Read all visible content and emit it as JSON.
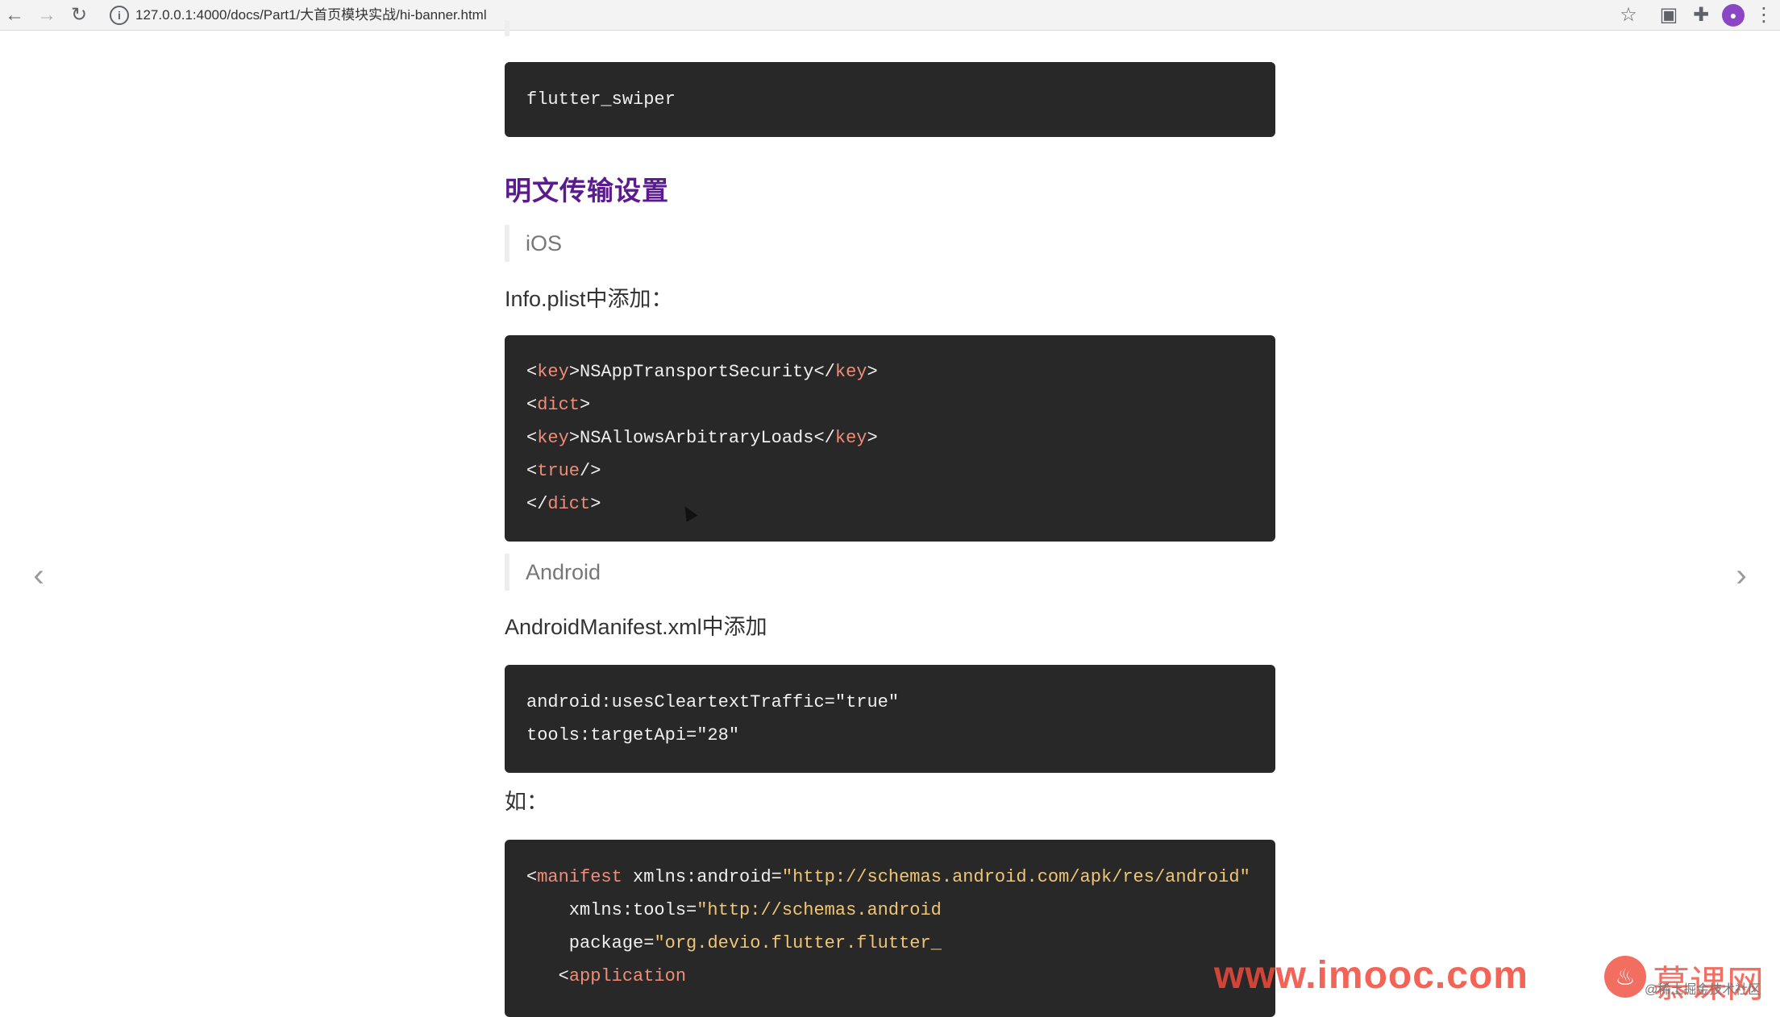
{
  "browser": {
    "url": "127.0.0.1:4000/docs/Part1/大首页模块实战/hi-banner.html",
    "back_icon": "←",
    "forward_icon": "→",
    "reload_icon": "↻",
    "info_icon": "i",
    "star_icon": "☆",
    "ext_icon": "▣",
    "puzzle_icon": "✚",
    "avatar_text": "●",
    "menu_icon": "⋮"
  },
  "content": {
    "code1": "flutter_swiper",
    "heading": "明文传输设置",
    "quote_ios": "iOS",
    "para_ios": "Info.plist中添加：",
    "ios_code": {
      "l1_open": "<",
      "l1_tag": "key",
      "l1_mid": ">NSAppTransportSecurity</",
      "l1_tag2": "key",
      "l1_close": ">",
      "l2_open": "<",
      "l2_tag": "dict",
      "l2_close": ">",
      "l3_open": "<",
      "l3_tag": "key",
      "l3_mid": ">NSAllowsArbitraryLoads</",
      "l3_tag2": "key",
      "l3_close": ">",
      "l4_open": "<",
      "l4_tag": "true",
      "l4_close": "/>",
      "l5_open": "</",
      "l5_tag": "dict",
      "l5_close": ">"
    },
    "quote_android": "Android",
    "para_android": "AndroidManifest.xml中添加",
    "android_code": {
      "l1": "android:usesCleartextTraffic=\"true\"",
      "l2": "tools:targetApi=\"28\""
    },
    "para_example": "如：",
    "manifest_code": {
      "l1_open": "<",
      "l1_tag": "manifest",
      "l1_attr": " xmlns:android=",
      "l1_val": "\"http://schemas.android.com/apk/res/android\"",
      "l2_attr": "    xmlns:tools=",
      "l2_val": "\"http://schemas.android",
      "l3_attr": "    package=",
      "l3_val": "\"org.devio.flutter.flutter_",
      "l4_open": "   <",
      "l4_tag": "application"
    }
  },
  "nav": {
    "prev_icon": "‹",
    "next_icon": "›"
  },
  "watermark": {
    "site": "www.imooc.com",
    "brand": "慕课网",
    "small": "@稀土掘金技术社区"
  }
}
